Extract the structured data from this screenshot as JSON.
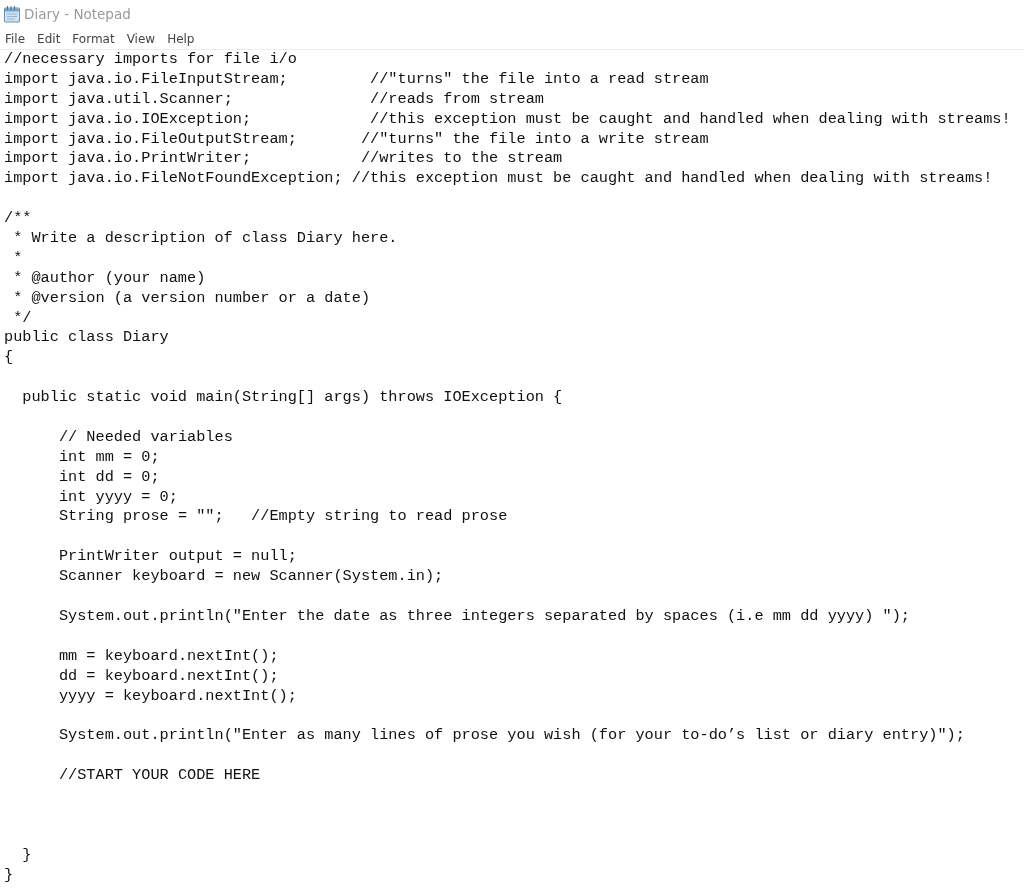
{
  "window": {
    "title": "Diary - Notepad"
  },
  "menu": [
    "File",
    "Edit",
    "Format",
    "View",
    "Help"
  ],
  "editor": {
    "lines": [
      {
        "kind": "code",
        "text": "//necessary imports for file i/o"
      },
      {
        "kind": "code",
        "text": "import java.io.FileInputStream;         //\"turns\" the file into a read stream"
      },
      {
        "kind": "code",
        "text": "import java.util.Scanner;               //reads from stream"
      },
      {
        "kind": "code",
        "text": "import java.io.IOException;             //this exception must be caught and handled when dealing with streams!"
      },
      {
        "kind": "code",
        "text": "import java.io.FileOutputStream;       //\"turns\" the file into a write stream"
      },
      {
        "kind": "code",
        "text": "import java.io.PrintWriter;            //writes to the stream"
      },
      {
        "kind": "code",
        "text": "import java.io.FileNotFoundException; //this exception must be caught and handled when dealing with streams!"
      },
      {
        "kind": "blank"
      },
      {
        "kind": "code",
        "text": "/**"
      },
      {
        "kind": "doc",
        "text": "* Write a description of class Diary here."
      },
      {
        "kind": "doc",
        "text": "*"
      },
      {
        "kind": "doc",
        "text": "* @author (your name)"
      },
      {
        "kind": "doc",
        "text": "* @version (a version number or a date)"
      },
      {
        "kind": "doc",
        "text": "*/"
      },
      {
        "kind": "code",
        "text": "public class Diary"
      },
      {
        "kind": "code",
        "text": "{",
        "children": [
          {
            "kind": "blank"
          },
          {
            "kind": "code",
            "text": "public static void main(String[] args) throws IOException {",
            "children": [
              {
                "kind": "blank"
              },
              {
                "kind": "code",
                "text": "// Needed variables"
              },
              {
                "kind": "code",
                "text": "int mm = 0;"
              },
              {
                "kind": "code",
                "text": "int dd = 0;"
              },
              {
                "kind": "code",
                "text": "int yyyy = 0;"
              },
              {
                "kind": "code",
                "text": "String prose = \"\";   //Empty string to read prose"
              },
              {
                "kind": "blank"
              },
              {
                "kind": "code",
                "text": "PrintWriter output = null;"
              },
              {
                "kind": "code",
                "text": "Scanner keyboard = new Scanner(System.in);"
              },
              {
                "kind": "blank"
              },
              {
                "kind": "code",
                "text": "System.out.println(\"Enter the date as three integers separated by spaces (i.e mm dd yyyy) \");"
              },
              {
                "kind": "blank"
              },
              {
                "kind": "code",
                "text": "mm = keyboard.nextInt();"
              },
              {
                "kind": "code",
                "text": "dd = keyboard.nextInt();"
              },
              {
                "kind": "code",
                "text": "yyyy = keyboard.nextInt();"
              },
              {
                "kind": "blank"
              },
              {
                "kind": "code",
                "text": "System.out.println(\"Enter as many lines of prose you wish (for your to-do’s list or diary entry)\");"
              },
              {
                "kind": "blank"
              },
              {
                "kind": "code",
                "text": "//START YOUR CODE HERE"
              },
              {
                "kind": "blank"
              },
              {
                "kind": "blank"
              },
              {
                "kind": "blank"
              }
            ]
          },
          {
            "kind": "code",
            "text": "}"
          }
        ]
      },
      {
        "kind": "code",
        "text": "}"
      }
    ]
  }
}
